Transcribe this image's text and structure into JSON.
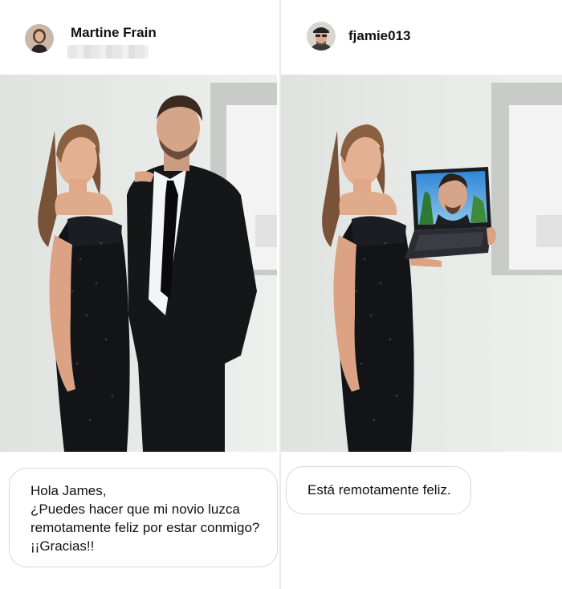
{
  "left_post": {
    "username": "Martine Frain",
    "message_lines": [
      "Hola James,",
      "¿Puedes hacer que mi novio luzca",
      "remotamente feliz por estar conmigo?",
      "¡¡Gracias!!"
    ]
  },
  "right_post": {
    "username": "fjamie013",
    "reply": "Está remotamente feliz."
  },
  "icons": {
    "left_avatar": "woman-avatar",
    "right_avatar": "man-avatar"
  }
}
